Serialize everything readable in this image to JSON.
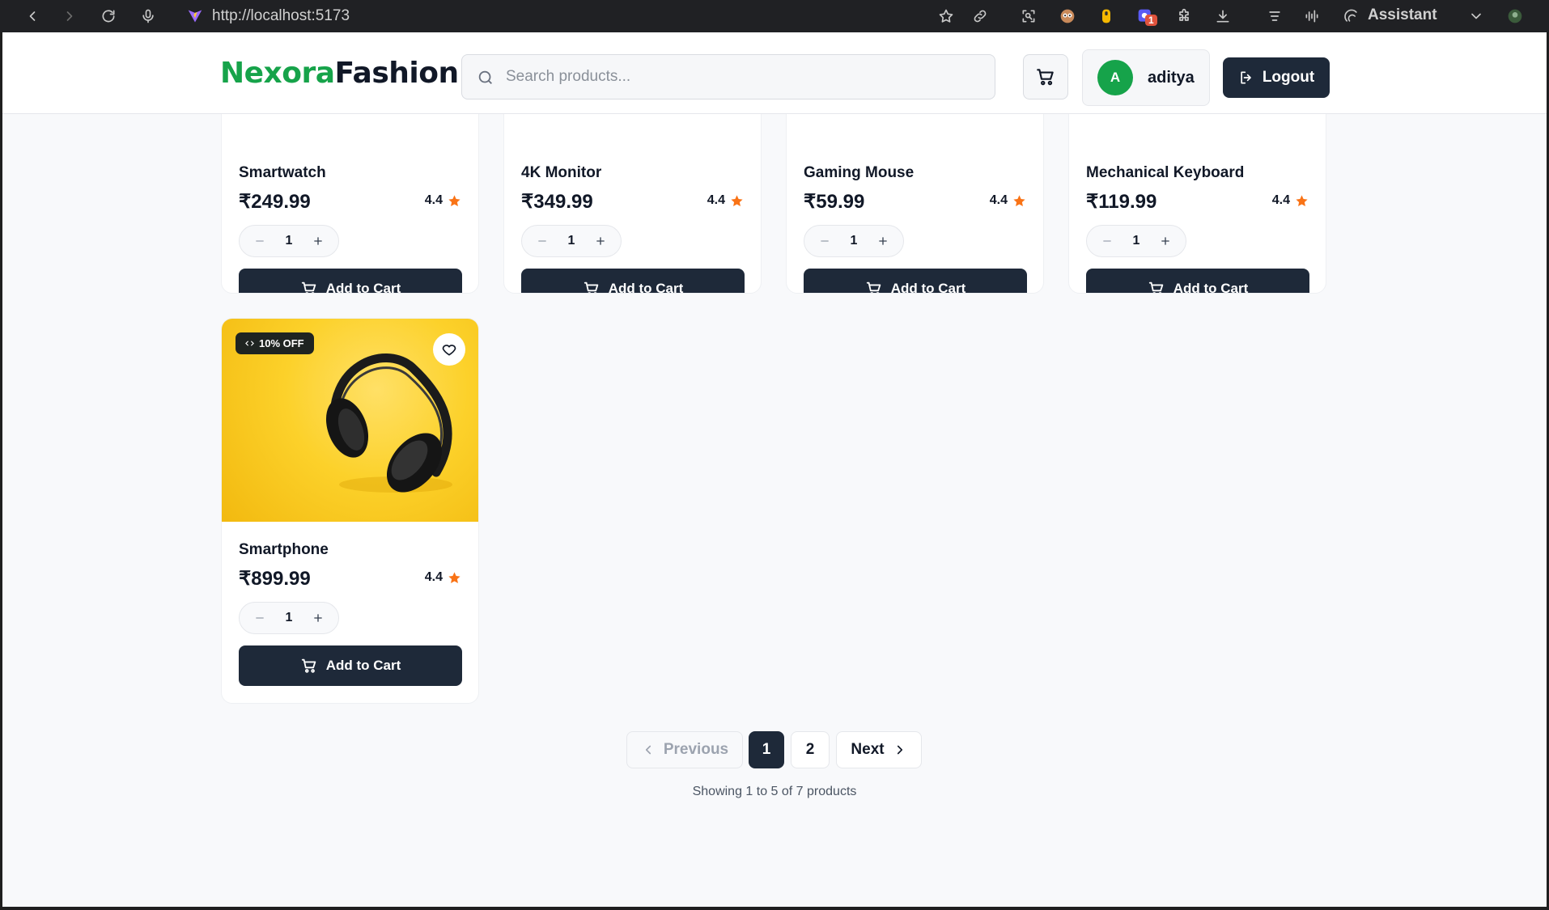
{
  "browser": {
    "url": "http://localhost:5173",
    "assistant_label": "Assistant",
    "extension_badge": "1"
  },
  "header": {
    "logo_part1": "Nexora",
    "logo_part2": "Fashion",
    "search_placeholder": "Search products...",
    "user_initial": "A",
    "username": "aditya",
    "logout_label": "Logout"
  },
  "products": [
    {
      "name": "Smartwatch",
      "price": "₹249.99",
      "rating": "4.4",
      "qty": "1",
      "add_label": "Add to Cart"
    },
    {
      "name": "4K Monitor",
      "price": "₹349.99",
      "rating": "4.4",
      "qty": "1",
      "add_label": "Add to Cart"
    },
    {
      "name": "Gaming Mouse",
      "price": "₹59.99",
      "rating": "4.4",
      "qty": "1",
      "add_label": "Add to Cart"
    },
    {
      "name": "Mechanical Keyboard",
      "price": "₹119.99",
      "rating": "4.4",
      "qty": "1",
      "add_label": "Add to Cart"
    },
    {
      "name": "Smartphone",
      "price": "₹899.99",
      "rating": "4.4",
      "qty": "1",
      "add_label": "Add to Cart",
      "badge": "10% OFF",
      "image": "headphones-on-yellow"
    }
  ],
  "pagination": {
    "previous_label": "Previous",
    "pages": [
      "1",
      "2"
    ],
    "current_page": "1",
    "next_label": "Next",
    "summary": "Showing 1 to 5 of 7 products"
  },
  "colors": {
    "brand_green": "#16a34a",
    "dark_button": "#1e2939",
    "star_orange": "#f97316",
    "image_bg": "#fcd12a"
  }
}
